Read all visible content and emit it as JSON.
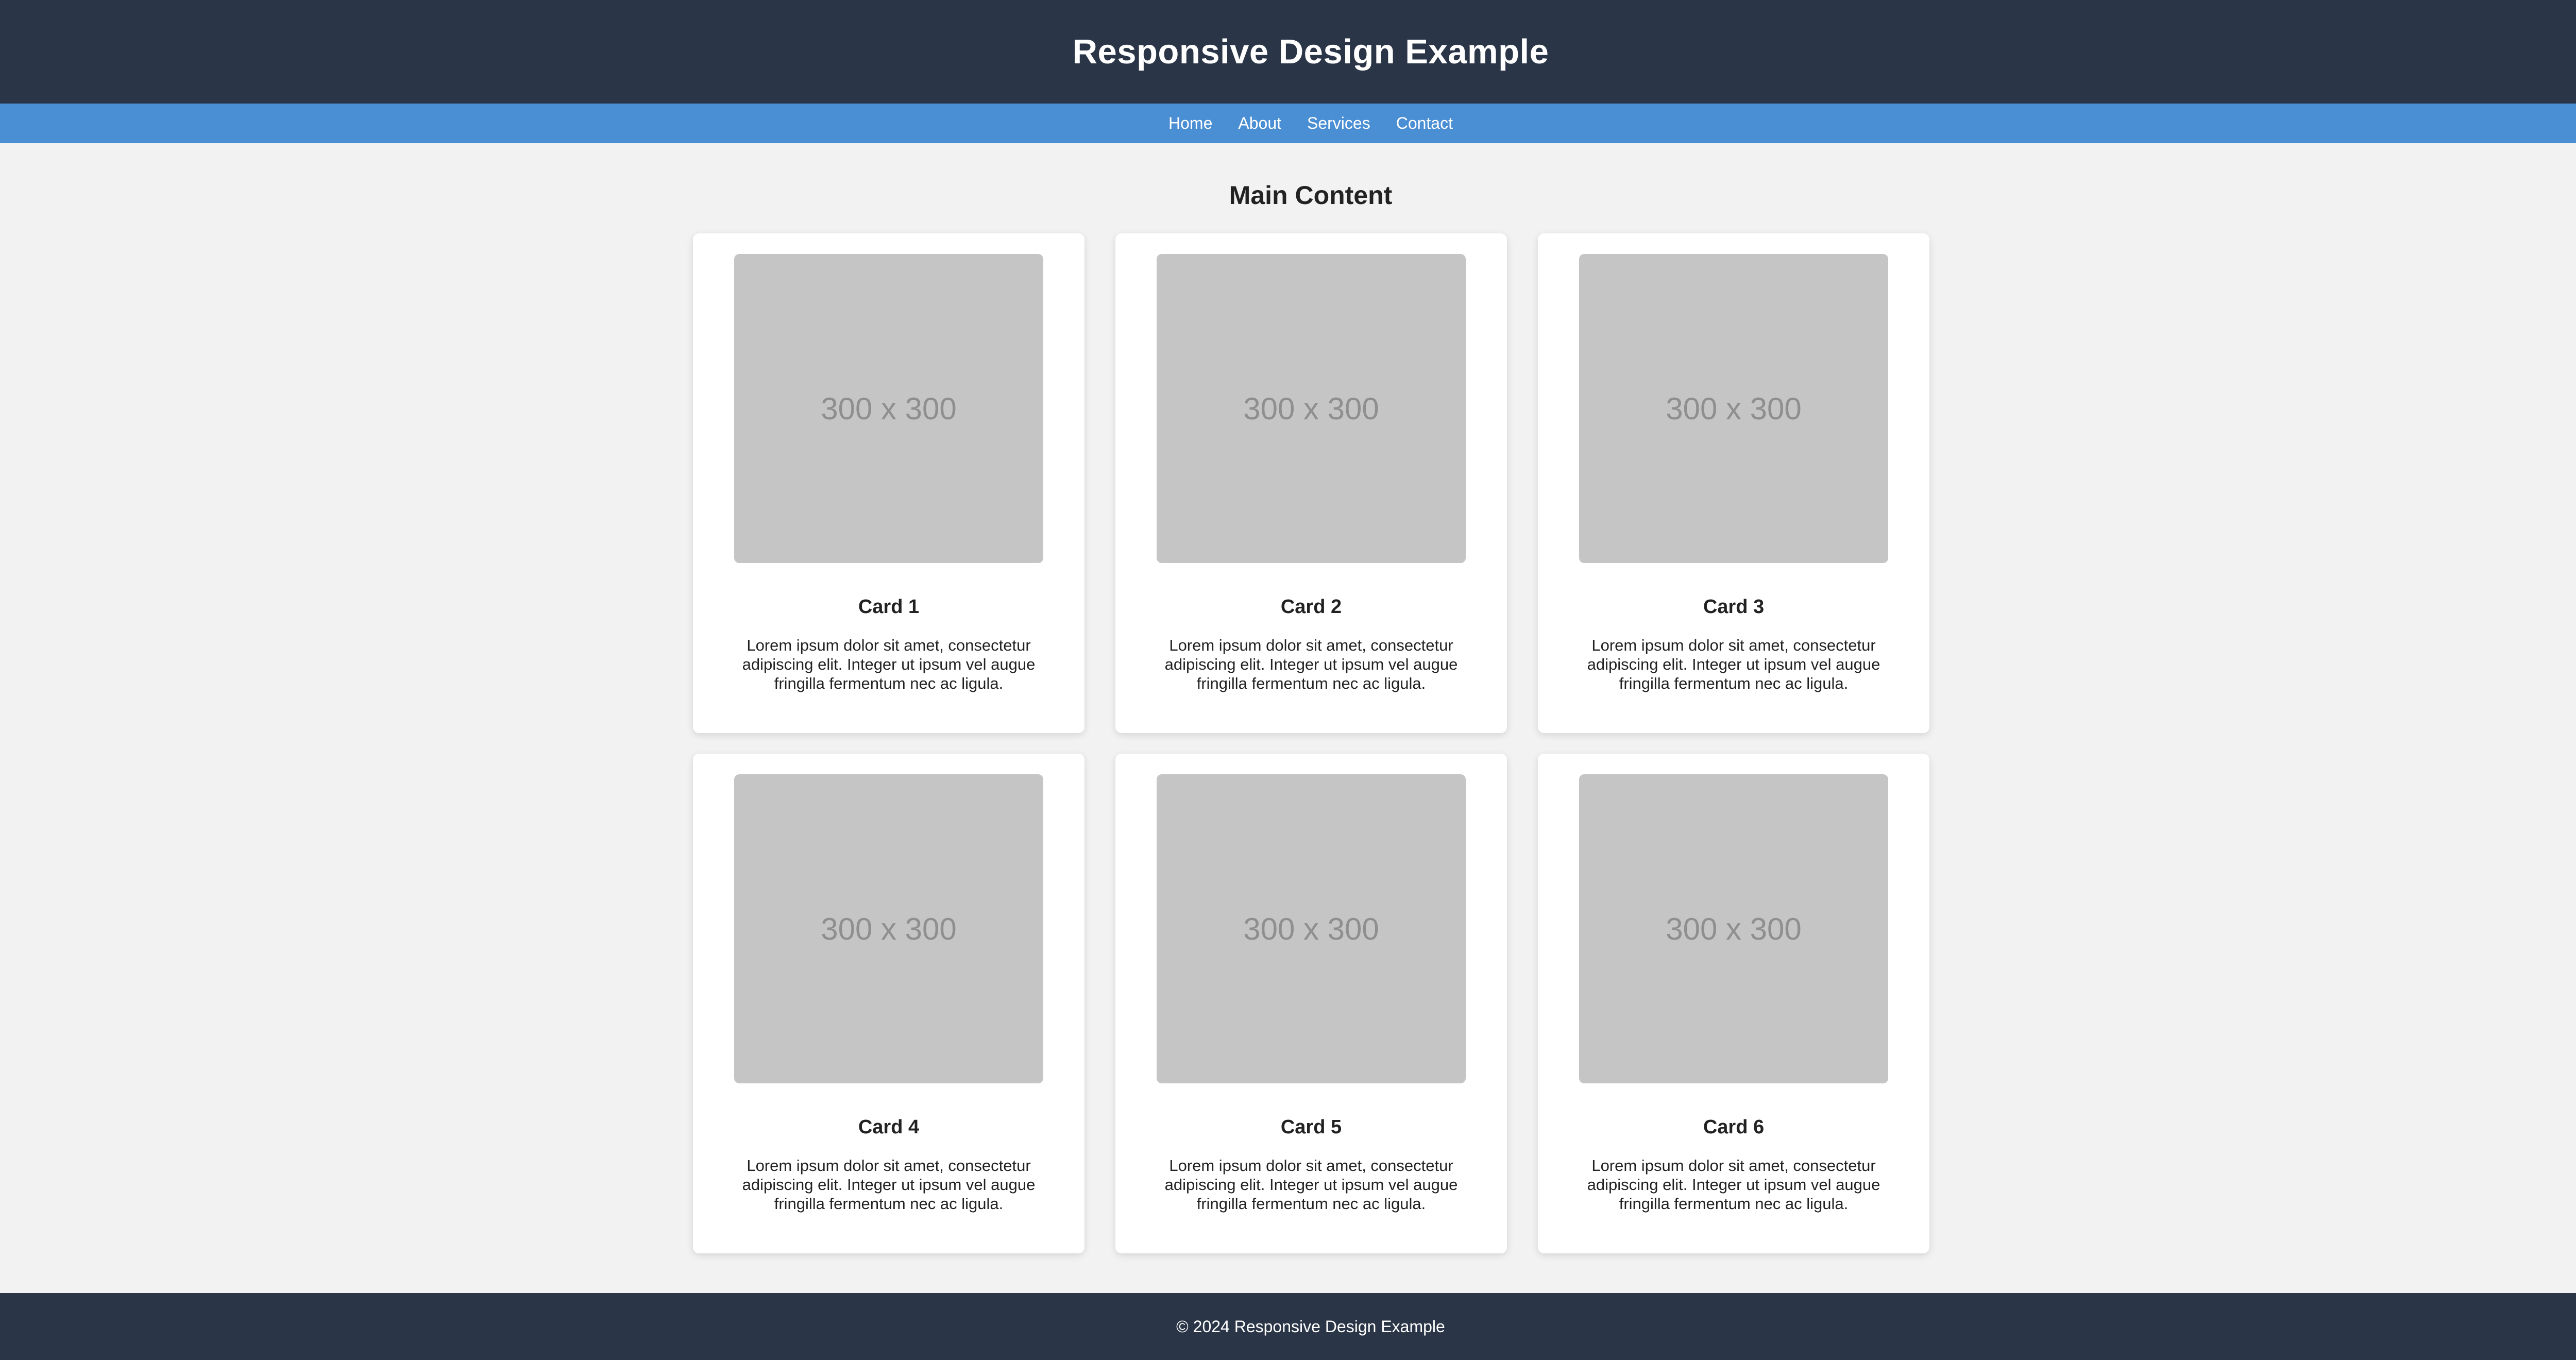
{
  "header": {
    "title": "Responsive Design Example"
  },
  "nav": {
    "items": [
      {
        "label": "Home"
      },
      {
        "label": "About"
      },
      {
        "label": "Services"
      },
      {
        "label": "Contact"
      }
    ]
  },
  "main": {
    "title": "Main Content",
    "cards": [
      {
        "image_label": "300 x 300",
        "title": "Card 1",
        "text": "Lorem ipsum dolor sit amet, consectetur adipiscing elit. Integer ut ipsum vel augue fringilla fermentum nec ac ligula."
      },
      {
        "image_label": "300 x 300",
        "title": "Card 2",
        "text": "Lorem ipsum dolor sit amet, consectetur adipiscing elit. Integer ut ipsum vel augue fringilla fermentum nec ac ligula."
      },
      {
        "image_label": "300 x 300",
        "title": "Card 3",
        "text": "Lorem ipsum dolor sit amet, consectetur adipiscing elit. Integer ut ipsum vel augue fringilla fermentum nec ac ligula."
      },
      {
        "image_label": "300 x 300",
        "title": "Card 4",
        "text": "Lorem ipsum dolor sit amet, consectetur adipiscing elit. Integer ut ipsum vel augue fringilla fermentum nec ac ligula."
      },
      {
        "image_label": "300 x 300",
        "title": "Card 5",
        "text": "Lorem ipsum dolor sit amet, consectetur adipiscing elit. Integer ut ipsum vel augue fringilla fermentum nec ac ligula."
      },
      {
        "image_label": "300 x 300",
        "title": "Card 6",
        "text": "Lorem ipsum dolor sit amet, consectetur adipiscing elit. Integer ut ipsum vel augue fringilla fermentum nec ac ligula."
      }
    ]
  },
  "footer": {
    "text": "© 2024 Responsive Design Example"
  },
  "colors": {
    "header_bg": "#2a3547",
    "nav_bg": "#4a8ed4",
    "page_bg": "#f2f2f2",
    "placeholder_bg": "#c5c5c5"
  }
}
